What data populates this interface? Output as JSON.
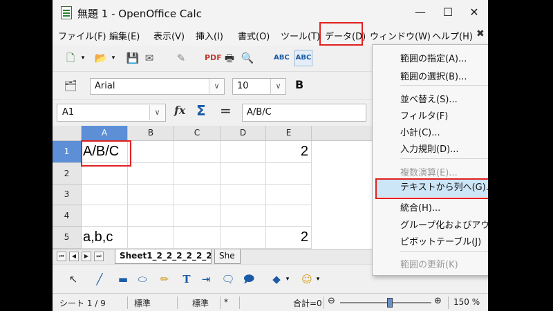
{
  "window": {
    "title": "無題 1 - OpenOffice Calc"
  },
  "menu": {
    "file": "ファイル(F)",
    "edit": "編集(E)",
    "view": "表示(V)",
    "insert": "挿入(I)",
    "format": "書式(O)",
    "tools": "ツール(T)",
    "data": "データ(D)",
    "window": "ウィンドウ(W)",
    "help": "ヘルプ(H)"
  },
  "font": {
    "name": "Arial",
    "size": "10",
    "bold": "B"
  },
  "formula": {
    "cell_ref": "A1",
    "content": "A/B/C"
  },
  "columns": [
    "A",
    "B",
    "C",
    "D",
    "E"
  ],
  "rows": [
    "1",
    "2",
    "3",
    "4",
    "5"
  ],
  "cells": {
    "A1": "A/B/C",
    "E1": "2",
    "A5": "a,b,c",
    "E5": "2"
  },
  "sheet_tabs": [
    "Sheet1_2_2_2_2_2_2",
    "She"
  ],
  "status": {
    "sheet": "シート 1 / 9",
    "style": "標準",
    "mode": "標準",
    "modified": "*",
    "sum": "合計=0",
    "zoom": "150 %"
  },
  "data_menu": {
    "items": [
      {
        "label": "範囲の指定(A)...",
        "enabled": true,
        "submenu": false
      },
      {
        "label": "範囲の選択(B)...",
        "enabled": true,
        "submenu": false
      },
      {
        "label": "並べ替え(S)...",
        "enabled": true,
        "submenu": false
      },
      {
        "label": "フィルタ(F)",
        "enabled": true,
        "submenu": true
      },
      {
        "label": "小計(C)...",
        "enabled": true,
        "submenu": false
      },
      {
        "label": "入力規則(D)...",
        "enabled": true,
        "submenu": false
      },
      {
        "label": "複数演算(E)...",
        "enabled": false,
        "submenu": false
      },
      {
        "label": "テキストから列へ(G)...",
        "enabled": true,
        "submenu": false,
        "highlighted": true
      },
      {
        "label": "統合(H)...",
        "enabled": true,
        "submenu": false
      },
      {
        "label": "グループ化およびアウトライン(I)",
        "enabled": true,
        "submenu": true
      },
      {
        "label": "ピボットテーブル(J)",
        "enabled": true,
        "submenu": true
      },
      {
        "label": "範囲の更新(K)",
        "enabled": false,
        "submenu": false
      }
    ]
  },
  "colors": {
    "highlight_box": "#e02020",
    "selected_header": "#5c8fd6",
    "menu_hover": "#cde6f7"
  }
}
